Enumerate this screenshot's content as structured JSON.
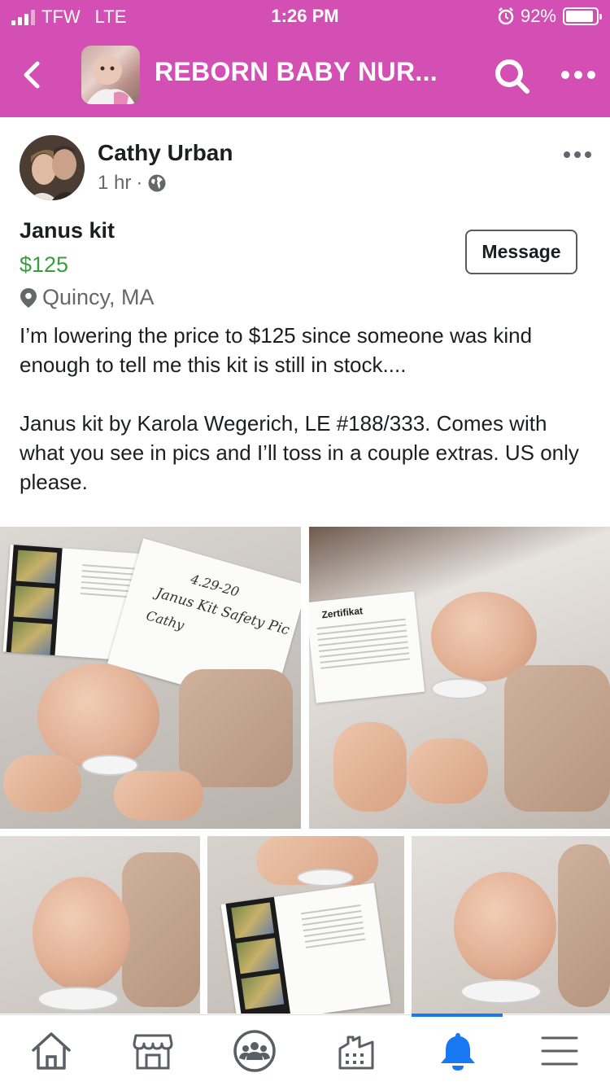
{
  "status_bar": {
    "carrier": "TFW",
    "network": "LTE",
    "time": "1:26 PM",
    "battery": "92%",
    "battery_level": 0.92
  },
  "header": {
    "title": "REBORN BABY NUR...",
    "background_color": "#d44fb4"
  },
  "post": {
    "author": "Cathy Urban",
    "time": "1 hr",
    "separator": "·",
    "audience_icon": "globe-icon",
    "item_title": "Janus kit",
    "price": "$125",
    "location": "Quincy, MA",
    "message_button": "Message",
    "description": [
      "I’m lowering the price to $125 since someone was kind enough to tell me this kit is still in stock....",
      "Janus kit by Karola Wegerich, LE #188/333. Comes with what you see in pics and I’ll toss in a couple extras. US only please."
    ]
  },
  "photos": {
    "note_lines": [
      "4.29-20",
      "Janus Kit Safety Pic",
      "Cathy"
    ],
    "certificate_title": "Zertifikat"
  },
  "bottom_nav": {
    "items": [
      "home-icon",
      "marketplace-icon",
      "groups-icon",
      "pages-icon",
      "notifications-icon",
      "menu-icon"
    ],
    "active_index": 4,
    "active_color": "#1877f2"
  }
}
